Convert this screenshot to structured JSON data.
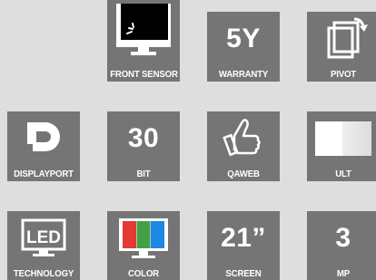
{
  "tiles": {
    "front_sensor": {
      "label": "FRONT SENSOR",
      "icon": "monitor-sensor-icon"
    },
    "warranty": {
      "label": "WARRANTY",
      "value": "5Y"
    },
    "pivot": {
      "label": "PIVOT",
      "icon": "pivot-rotate-icon"
    },
    "displayport": {
      "label": "DISPLAYPORT",
      "icon": "displayport-logo-icon"
    },
    "bit": {
      "label": "BIT",
      "value": "30"
    },
    "qaweb": {
      "label": "QAWEB",
      "icon": "thumbs-up-icon"
    },
    "ult": {
      "label": "ULT",
      "icon": "uniform-luminance-icon"
    },
    "technology": {
      "label": "TECHNOLOGY",
      "icon": "led-monitor-icon",
      "icon_text": "LED"
    },
    "color": {
      "label": "COLOR",
      "icon": "color-monitor-icon"
    },
    "screen": {
      "label": "SCREEN",
      "value": "21”"
    },
    "mp": {
      "label": "MP",
      "value": "3"
    }
  },
  "colors": {
    "tile_bg": "#757575",
    "page_bg": "#dedede",
    "text": "#ffffff",
    "red": "#e53935",
    "green": "#43a047",
    "blue": "#1e88e5"
  }
}
